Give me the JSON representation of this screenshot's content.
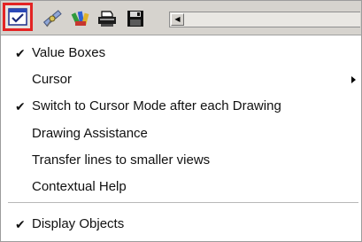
{
  "toolbar": {
    "buttons": [
      {
        "icon": "checkbox-window-icon"
      },
      {
        "icon": "satellite-icon"
      },
      {
        "icon": "colored-pencils-icon"
      },
      {
        "icon": "printer-icon"
      },
      {
        "icon": "floppy-disk-icon"
      }
    ],
    "scroll_arrow": "◀"
  },
  "menu": {
    "items": [
      {
        "label": "Value Boxes",
        "checked": "✔"
      },
      {
        "label": "Cursor",
        "checked": ""
      },
      {
        "label": "Switch to Cursor Mode after each Drawing",
        "checked": "✔"
      },
      {
        "label": "Drawing Assistance",
        "checked": ""
      },
      {
        "label": "Transfer lines to smaller views",
        "checked": ""
      },
      {
        "label": "Contextual Help",
        "checked": ""
      },
      {
        "label": "Display Objects",
        "checked": "✔"
      }
    ]
  },
  "colors": {
    "highlight": "#e32424",
    "toolbar_bg": "#d6d3ce"
  }
}
